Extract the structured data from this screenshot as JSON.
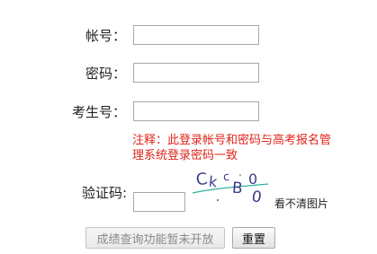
{
  "form": {
    "account_label": "帐号：",
    "password_label": "密码：",
    "exam_no_label": "考生号：",
    "note_text": "注释：此登录帐号和密码与高考报名管理系统登录密码一致",
    "captcha_label": "验证码:",
    "captcha_chars": [
      "C",
      "k",
      "c",
      "B",
      "0",
      "0"
    ],
    "captcha_refresh_text": "看不清图片",
    "account_value": "",
    "password_value": "",
    "exam_no_value": "",
    "captcha_value": ""
  },
  "buttons": {
    "query_label": "成绩查询功能暂未开放",
    "reset_label": "重置"
  },
  "colors": {
    "note": "#e0241b",
    "captcha_text": "#3a3a8c",
    "captcha_line": "#2fb3a0"
  }
}
